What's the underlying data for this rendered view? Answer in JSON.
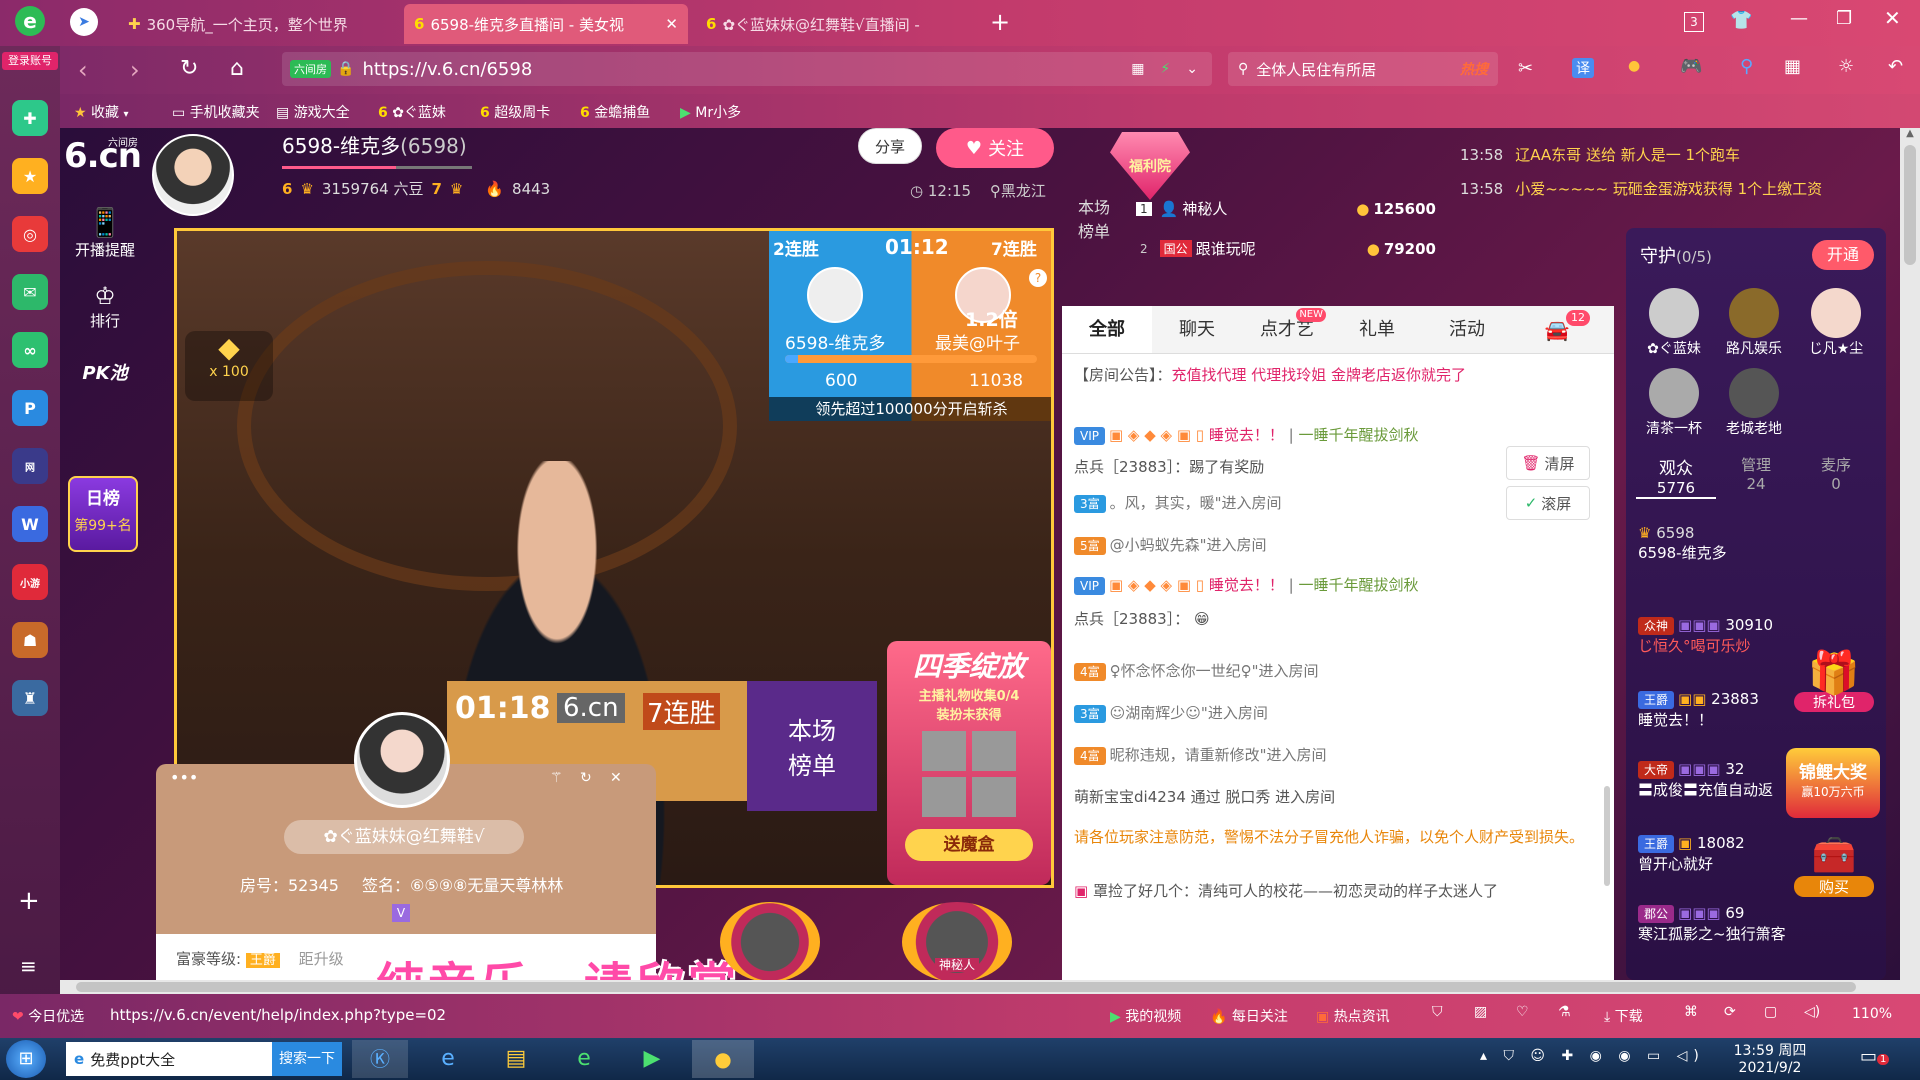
{
  "browser": {
    "profile_label": "登录账号",
    "tabs": [
      {
        "label": "360导航_一个主页，整个世界"
      },
      {
        "label": "6598-维克多直播间 - 美女视"
      },
      {
        "label": "✿ぐ蓝妹妹@红舞鞋√直播间 -"
      }
    ],
    "tab_counter": "3",
    "url": "https://v.6.cn/6598",
    "url_prefix": "六间房",
    "search_placeholder": "全体人民住有所居",
    "search_hot": "热搜",
    "translate_label": "译",
    "bookmarks": [
      {
        "label": "收藏"
      },
      {
        "label": "手机收藏夹"
      },
      {
        "label": "游戏大全"
      },
      {
        "label": "✿ぐ蓝妹"
      },
      {
        "label": "超级周卡"
      },
      {
        "label": "金蟾捕鱼"
      },
      {
        "label": "Mr小多"
      }
    ]
  },
  "left_sidebar": {
    "items": [
      {
        "label": "开播提醒"
      },
      {
        "label": "排行"
      },
      {
        "label": "PK池"
      }
    ],
    "rank_badge": {
      "title": "日榜",
      "value": "第99+名"
    }
  },
  "site": {
    "logo": "6.cn",
    "logo_sub": "六间房"
  },
  "anchor": {
    "name": "6598-维克多",
    "id": "(6598)",
    "level_a": "6",
    "beans": "3159764 六豆",
    "level_b": "7",
    "fans": "8443",
    "share_label": "分享",
    "follow_label": "关注",
    "time": "12:15",
    "location": "黑龙江"
  },
  "welfare": {
    "label": "福利院"
  },
  "marquee": [
    {
      "time": "13:58",
      "text": "辽AA东哥 送给 新人是一 1个跑车"
    },
    {
      "time": "13:58",
      "text": "小爱~~~~~ 玩砸金蛋游戏获得 1个上缴工资"
    }
  ],
  "pk": {
    "left_streak": "2连胜",
    "timer": "01:12",
    "right_streak": "7连胜",
    "left_name": "6598-维克多",
    "right_name": "最美@叶子",
    "multiplier": "1.2倍",
    "left_score": "600",
    "right_score": "11038",
    "left_fraction": 0.05,
    "notice": "领先超过100000分开启斩杀",
    "hint": "?"
  },
  "gift_float": {
    "count": "x 100"
  },
  "inner_pk": {
    "timer": "01:18",
    "logo": "6.cn",
    "streak": "7连胜",
    "board": "本场榜单"
  },
  "season": {
    "title": "四季绽放",
    "sub1": "主播礼物收集0/4",
    "sub2": "装扮未获得",
    "btn": "送魔盒"
  },
  "profile_card": {
    "name": "✿ぐ蓝妹妹@红舞鞋√",
    "room": "房号：52345",
    "sign": "签名：⑥⑤⑨⑧无量天尊林林",
    "vip": "V",
    "rich_label": "富豪等级:",
    "rich_badge": "王爵",
    "upgrade": "距升级"
  },
  "subtitle": "纯音乐，请欣赏",
  "bottom_avatars": [
    {
      "label": ""
    },
    {
      "label": "神秘人"
    }
  ],
  "rank_board": {
    "title": "本场榜单",
    "rows": [
      {
        "rank": "1",
        "name": "神秘人",
        "score": "125600"
      },
      {
        "rank": "2",
        "tag": "国公",
        "name": "跟谁玩呢",
        "score": "79200"
      }
    ]
  },
  "chat": {
    "tabs": [
      {
        "label": "全部"
      },
      {
        "label": "聊天"
      },
      {
        "label": "点才艺"
      },
      {
        "label": "礼单"
      },
      {
        "label": "活动"
      }
    ],
    "new_tag": "NEW",
    "car_count": "12",
    "notice_label": "【房间公告】：",
    "notice_text": "充值找代理 代理找玲姐 金牌老店返你就完了",
    "lines": [
      {
        "badge": "VIP",
        "name": "睡觉去！！",
        "sep": "|",
        "msg": "一睡千年醒拔剑秋"
      },
      {
        "text": "点兵［23883］：踢了有奖励"
      },
      {
        "badge": "3富",
        "text": "。风，其实，暖\"进入房间"
      },
      {
        "badge": "5富",
        "text": "@小蚂蚁先森\"进入房间"
      },
      {
        "badge": "VIP",
        "name": "睡觉去！！",
        "sep": "|",
        "msg": "一睡千年醒拔剑秋"
      },
      {
        "text": "点兵［23883］："
      },
      {
        "badge": "4富",
        "text": "♀怀念怀念你一世纪♀\"进入房间"
      },
      {
        "badge": "3富",
        "text": "☺湖南辉少☺\"进入房间"
      },
      {
        "badge": "4富",
        "text": "昵称违规，请重新修改\"进入房间"
      },
      {
        "text": "萌新宝宝di4234 通过 脱口秀 进入房间"
      }
    ],
    "clear_label": "清屏",
    "scroll_label": "滚屏",
    "warning": "请各位玩家注意防范，警惕不法分子冒充他人诈骗，以免个人财产受到损失。",
    "bottom_line": "罩捡了好几个：清纯可人的校花——初恋灵动的样子太迷人了"
  },
  "guard": {
    "title": "守护",
    "count": "(0/5)",
    "open_label": "开通",
    "members": [
      {
        "name": "✿ぐ蓝妹"
      },
      {
        "name": "路凡娱乐"
      },
      {
        "name": "じ凡★尘"
      },
      {
        "name": "清茶一杯"
      },
      {
        "name": "老城老地"
      }
    ],
    "tabs": [
      {
        "label": "观众",
        "value": "5776"
      },
      {
        "label": "管理",
        "value": "24"
      },
      {
        "label": "麦序",
        "value": "0"
      }
    ],
    "viewers": [
      {
        "badge": "6598",
        "name": "6598-维克多"
      },
      {
        "badge": "众神",
        "name": "じ恒久°喝可乐炒",
        "score": "30910"
      },
      {
        "badge": "王爵",
        "name": "睡觉去！！",
        "score": "23883"
      },
      {
        "badge": "大帝",
        "name": "〓成俊〓充值自动返",
        "score": "32"
      },
      {
        "badge": "王爵",
        "name": "曾开心就好",
        "score": "18082"
      },
      {
        "badge": "郡公",
        "name": "寒江孤影之~独行箫客",
        "score": "69"
      }
    ],
    "gift_pack": "拆礼包",
    "koi": "锦鲤大奖",
    "koi_sub": "赢10万六币",
    "buy": "购买"
  },
  "statusbar": {
    "left_label": "今日优选",
    "url": "https://v.6.cn/event/help/index.php?type=02",
    "items": [
      {
        "label": "我的视频"
      },
      {
        "label": "每日关注"
      },
      {
        "label": "热点资讯"
      },
      {
        "label": "下载"
      }
    ],
    "zoom": "110%"
  },
  "taskbar": {
    "search_text": "免费ppt大全",
    "search_btn": "搜索一下",
    "time": "13:59 周四",
    "date": "2021/9/2",
    "notif": "1"
  },
  "colors": {
    "accent": "#e0246a",
    "brand_pink": "#ff5a8a",
    "gold": "#ffd34d"
  }
}
